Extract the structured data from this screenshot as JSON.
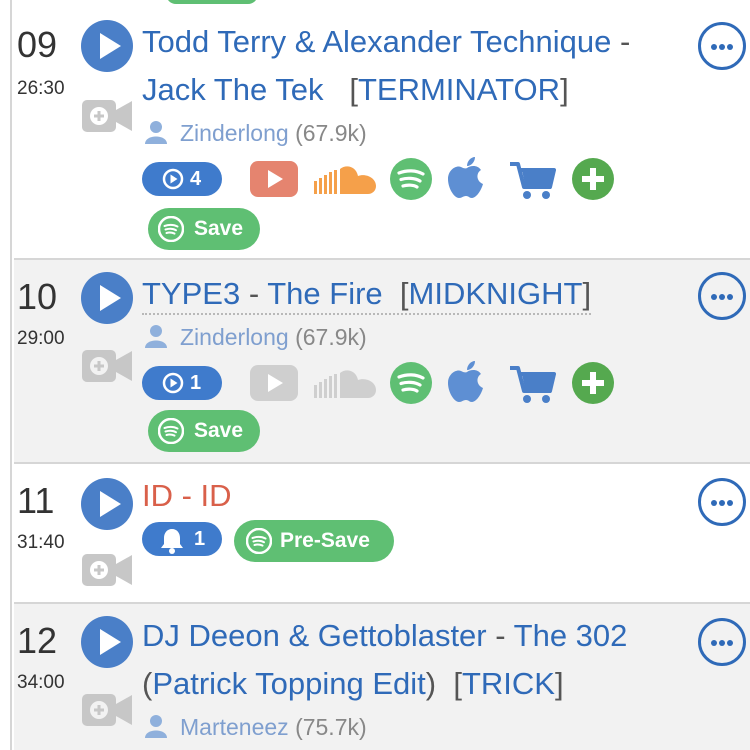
{
  "tracks": [
    {
      "number": "09",
      "time": "26:30",
      "title": {
        "artist": "Todd Terry & Alexander Technique",
        "separator": "-",
        "song": "Jack The Tek",
        "label": "TERMINATOR"
      },
      "user": {
        "name": "Zinderlong",
        "count": "(67.9k)"
      },
      "play_count": "4",
      "save_label": "Save"
    },
    {
      "number": "10",
      "time": "29:00",
      "title": {
        "artist": "TYPE3",
        "separator": "-",
        "song": "The Fire",
        "label": "MIDKNIGHT"
      },
      "user": {
        "name": "Zinderlong",
        "count": "(67.9k)"
      },
      "play_count": "1",
      "save_label": "Save"
    },
    {
      "number": "11",
      "time": "31:40",
      "title": {
        "text": "ID - ID"
      },
      "notify_count": "1",
      "presave_label": "Pre-Save"
    },
    {
      "number": "12",
      "time": "34:00",
      "title": {
        "artist": "DJ Deeon & Gettoblaster",
        "separator": "-",
        "song": "The 302",
        "open_paren": "(",
        "remix": "Patrick Topping Edit",
        "close_paren": ")",
        "label": "TRICK"
      },
      "user": {
        "name": "Marteneez",
        "count": "(75.7k)"
      }
    }
  ],
  "icons": {
    "play": "play-icon",
    "video": "video-camera-icon",
    "user": "user-icon",
    "youtube": "youtube-icon",
    "soundcloud": "soundcloud-icon",
    "spotify": "spotify-icon",
    "apple": "apple-icon",
    "cart": "shopping-cart-icon",
    "add": "plus-circle-icon",
    "more": "more-options-icon",
    "bell": "bell-icon"
  },
  "colors": {
    "link_blue": "#2f6ab8",
    "play_blue": "#4a7fc8",
    "spotify_green": "#5fbf73",
    "id_red": "#d9604a",
    "youtube_red": "#e5846f",
    "soundcloud_orange": "#f5a04a",
    "row_gray": "#f2f2f2"
  }
}
